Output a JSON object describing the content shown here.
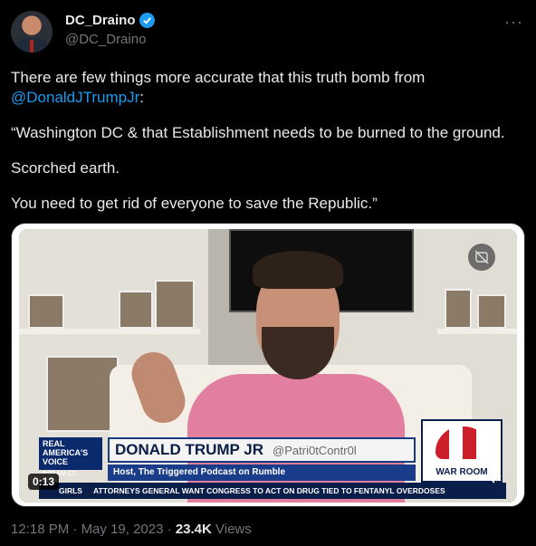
{
  "author": {
    "display_name": "DC_Draino",
    "handle": "@DC_Draino"
  },
  "tweet": {
    "line1_prefix": "There are few things more accurate that this truth bomb from",
    "mention": "@DonaldJTrumpJr",
    "line1_suffix": ":",
    "quote1": "“Washington DC & that Establishment needs to be burned to the ground.",
    "quote2": "Scorched earth.",
    "quote3": "You need to get rid of everyone to save the Republic.”"
  },
  "video": {
    "duration": "0:13",
    "overlay": {
      "network_line1": "REAL",
      "network_line2": "AMERICA'S",
      "network_line3": "VOICE",
      "network_time": "9:09 AM CT",
      "name": "DONALD TRUMP JR",
      "handle": "@Patri0tContr0l",
      "subtitle": "Host, The Triggered Podcast on Rumble",
      "ticker_left": "GIRLS",
      "ticker_text": "ATTORNEYS GENERAL WANT CONGRESS TO ACT ON DRUG TIED TO FENTANYL OVERDOSES",
      "logo_text": "WAR ROOM"
    }
  },
  "meta": {
    "time": "12:18 PM",
    "separator": "·",
    "date": "May 19, 2023",
    "views_count": "23.4K",
    "views_label": "Views"
  },
  "icons": {
    "verified": "verified-badge-icon",
    "more": "more-options-icon",
    "gif": "gif-icon",
    "mute": "speaker-mute-icon"
  },
  "colors": {
    "background": "#000000",
    "link": "#1d9bf0",
    "secondary_text": "#71767b",
    "primary_text": "#e7e9ea"
  }
}
